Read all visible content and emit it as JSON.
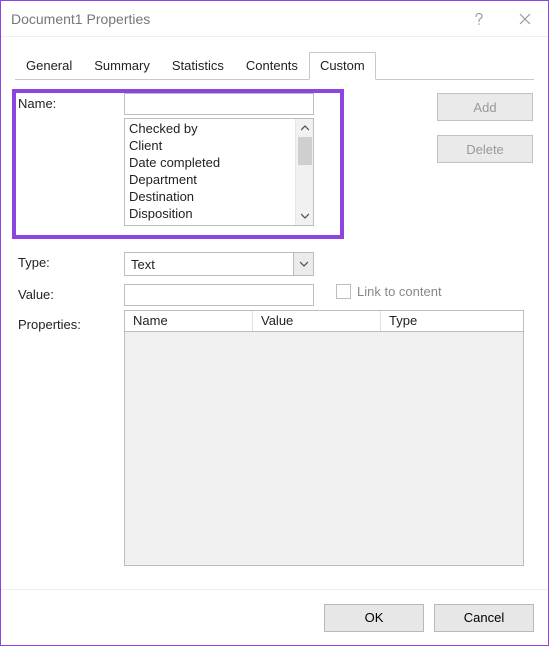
{
  "window": {
    "title": "Document1 Properties"
  },
  "tabs": {
    "items": [
      {
        "label": "General"
      },
      {
        "label": "Summary"
      },
      {
        "label": "Statistics"
      },
      {
        "label": "Contents"
      },
      {
        "label": "Custom"
      }
    ],
    "active_index": 4
  },
  "form": {
    "name_label": "Name:",
    "name_value": "",
    "name_suggestions": [
      "Checked by",
      "Client",
      "Date completed",
      "Department",
      "Destination",
      "Disposition"
    ],
    "add_button": "Add",
    "delete_button": "Delete",
    "type_label": "Type:",
    "type_value": "Text",
    "value_label": "Value:",
    "value_value": "",
    "link_checkbox_label": "Link to content",
    "link_checkbox_checked": false,
    "properties_label": "Properties:",
    "table_headers": {
      "name": "Name",
      "value": "Value",
      "type": "Type"
    }
  },
  "footer": {
    "ok": "OK",
    "cancel": "Cancel"
  }
}
